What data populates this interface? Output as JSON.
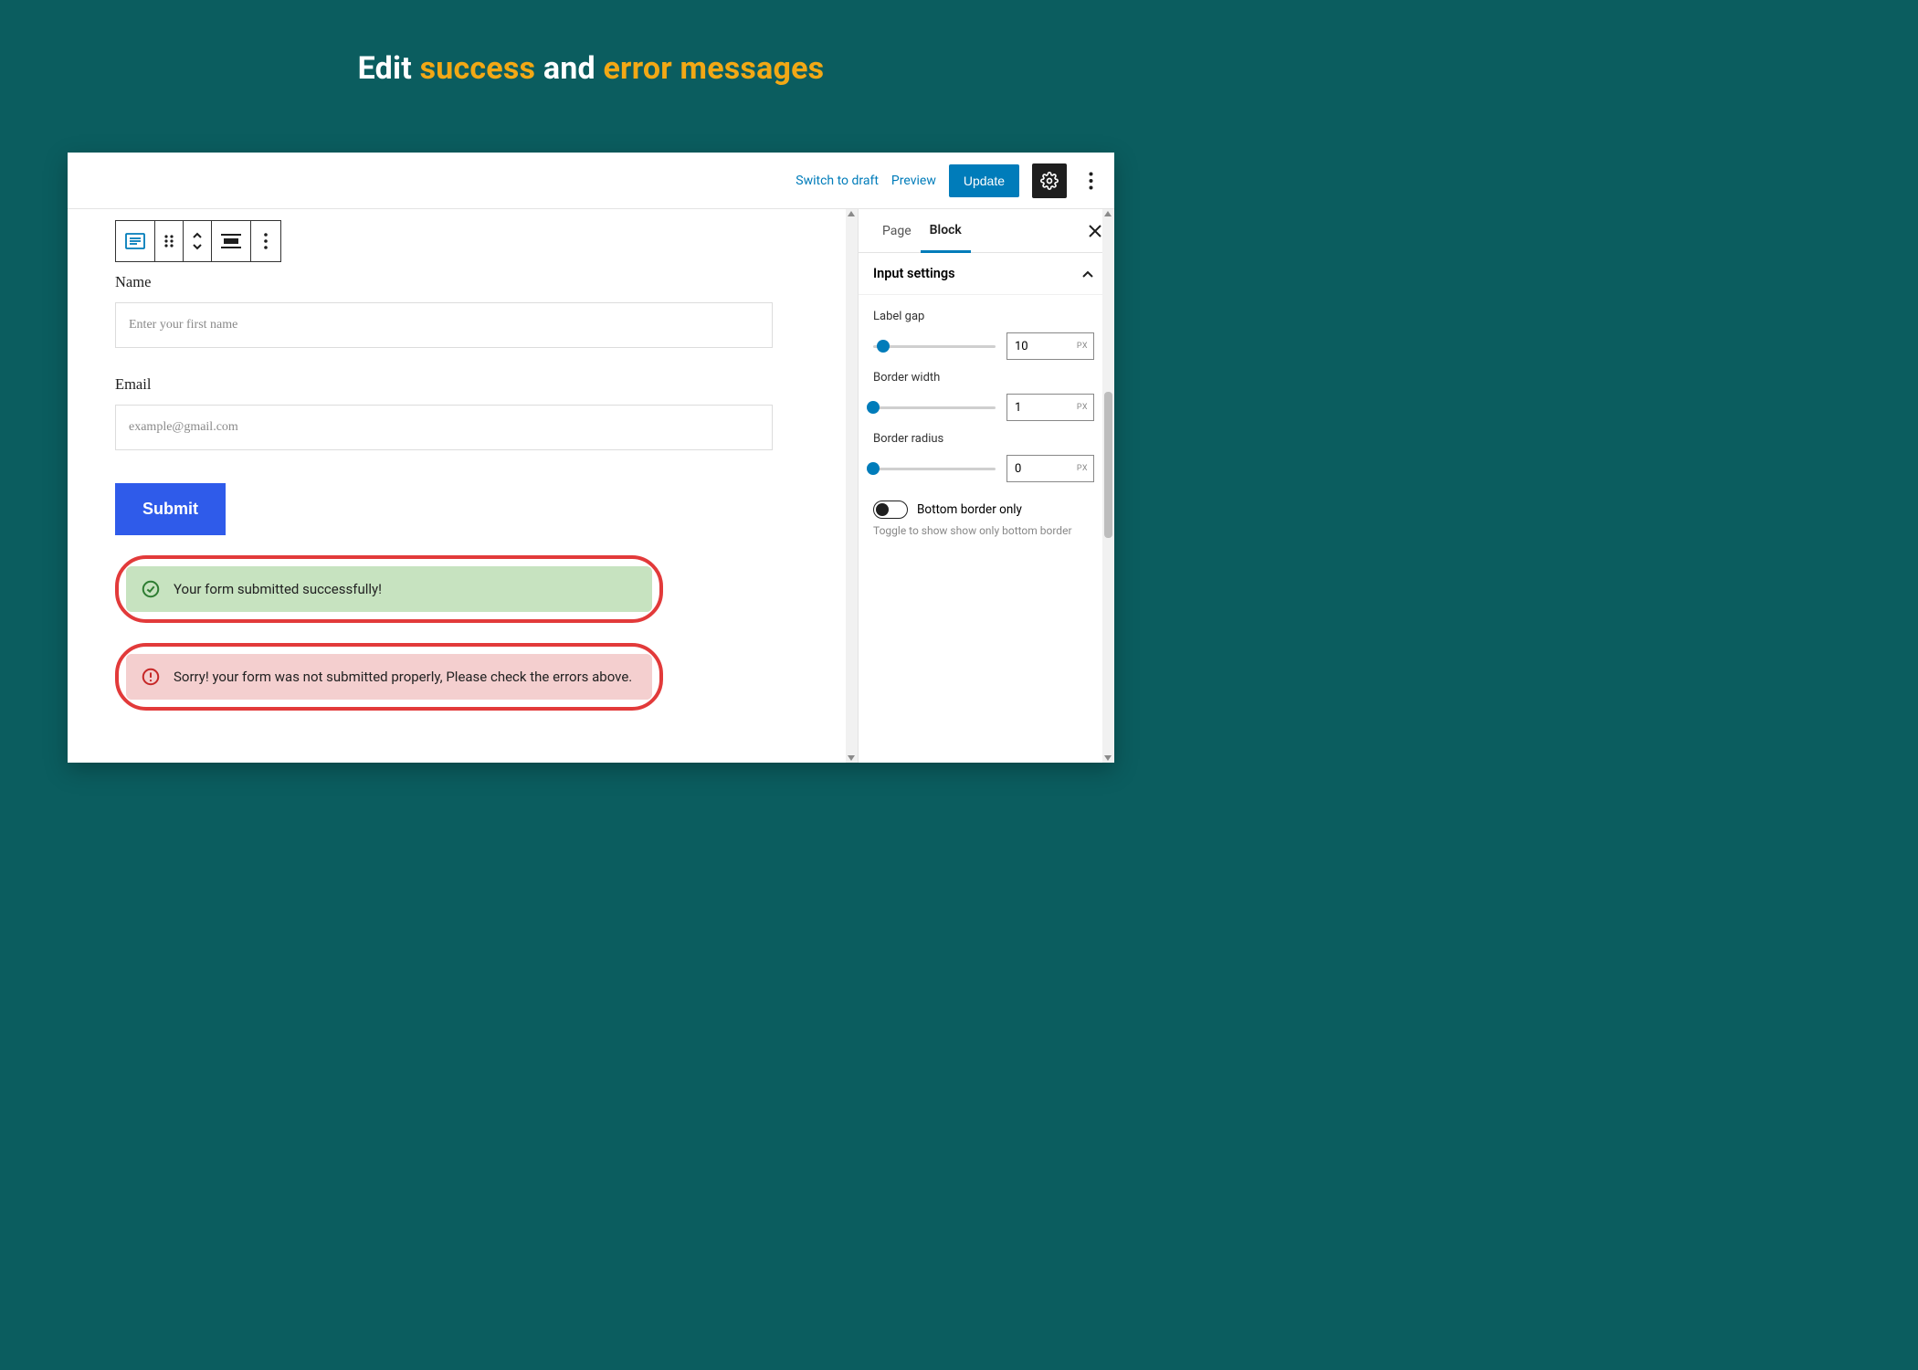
{
  "hero": {
    "p1": "Edit ",
    "p2": "success",
    "p3": " and ",
    "p4": "error messages"
  },
  "topbar": {
    "switch_draft": "Switch to draft",
    "preview": "Preview",
    "update": "Update"
  },
  "form": {
    "name_label": "Name",
    "name_placeholder": "Enter your first name",
    "email_label": "Email",
    "email_placeholder": "example@gmail.com",
    "submit": "Submit",
    "success_msg": "Your form submitted successfully!",
    "error_msg": "Sorry! your form was not submitted properly, Please check the errors above."
  },
  "sidebar": {
    "tab_page": "Page",
    "tab_block": "Block",
    "section_title": "Input settings",
    "label_gap": {
      "label": "Label gap",
      "value": "10",
      "unit": "PX",
      "pct": 8
    },
    "border_width": {
      "label": "Border width",
      "value": "1",
      "unit": "PX",
      "pct": 0
    },
    "border_radius": {
      "label": "Border radius",
      "value": "0",
      "unit": "PX",
      "pct": 0
    },
    "toggle_label": "Bottom border only",
    "toggle_help": "Toggle to show show only bottom border"
  }
}
